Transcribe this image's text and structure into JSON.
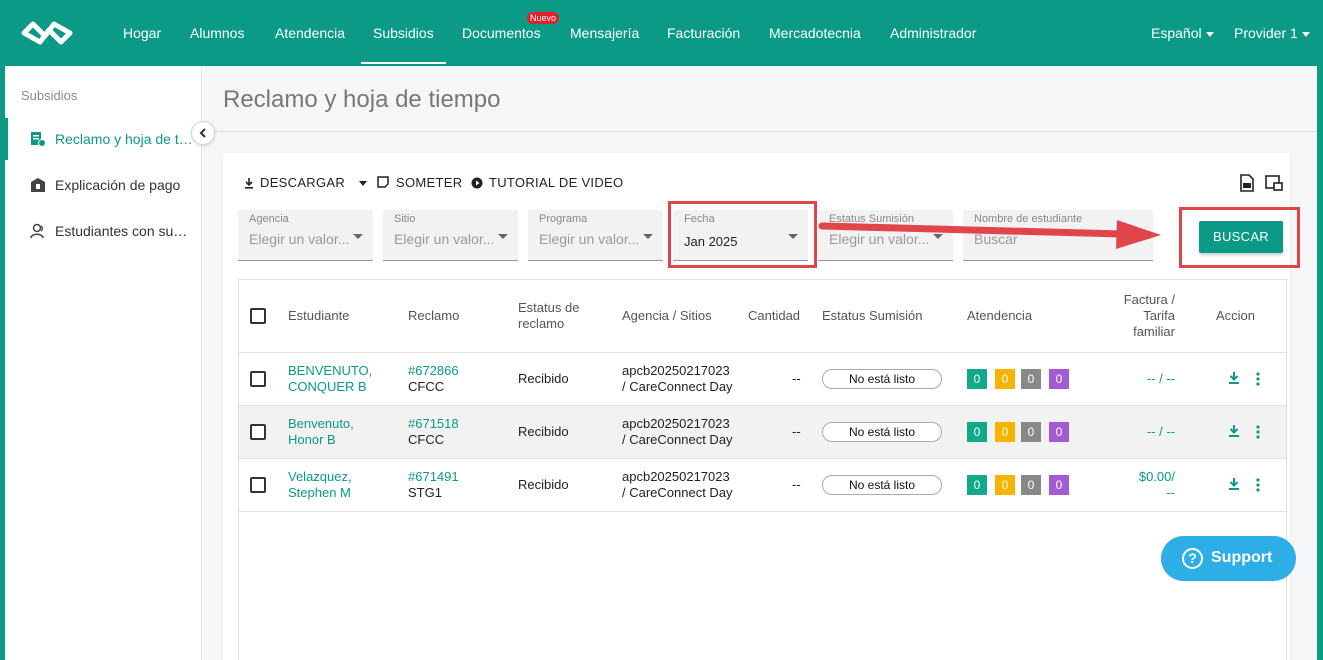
{
  "nav": {
    "items": [
      "Hogar",
      "Alumnos",
      "Atendencia",
      "Subsidios",
      "Documentos",
      "Mensajería",
      "Facturación",
      "Mercadotecnia",
      "Administrador"
    ],
    "active": "Subsidios",
    "new_badge": "Nuevo",
    "language": "Español",
    "user": "Provider 1"
  },
  "sidebar": {
    "heading": "Subsidios",
    "items": [
      {
        "label": "Reclamo y hoja de tiempo",
        "icon": "claim-document-icon"
      },
      {
        "label": "Explicación de pago",
        "icon": "payment-building-icon"
      },
      {
        "label": "Estudiantes con subsidio",
        "icon": "students-icon"
      }
    ]
  },
  "page": {
    "title": "Reclamo y hoja de tiempo"
  },
  "toolbar": {
    "download": "DESCARGAR",
    "submit": "SOMETER",
    "tutorial": "TUTORIAL DE VIDEO"
  },
  "filters": {
    "agency": {
      "label": "Agencia",
      "placeholder": "Elegir un valor..."
    },
    "site": {
      "label": "Sitio",
      "placeholder": "Elegir un valor..."
    },
    "program": {
      "label": "Programa",
      "placeholder": "Elegir un valor..."
    },
    "date": {
      "label": "Fecha",
      "value": "Jan 2025"
    },
    "submission_status": {
      "label": "Estatus Sumisión",
      "placeholder": "Elegir un valor..."
    },
    "student_name": {
      "label": "Nombre de estudiante",
      "placeholder": "Buscar"
    },
    "search_button": "BUSCAR"
  },
  "table": {
    "headers": {
      "student": "Estudiante",
      "claim": "Reclamo",
      "claim_status_1": "Estatus de",
      "claim_status_2": "reclamo",
      "agency_sites": "Agencia / Sitios",
      "amount": "Cantidad",
      "submission_status": "Estatus Sumisión",
      "attendance": "Atendencia",
      "invoice_1": "Factura /",
      "invoice_2": "Tarifa",
      "invoice_3": "familiar",
      "action": "Accion"
    },
    "rows": [
      {
        "student_1": "BENVENUTO,",
        "student_2": "CONQUER B",
        "claim_id": "#672866",
        "claim_type": "CFCC",
        "status": "Recibido",
        "agency_1": "apcb20250217023",
        "agency_2": "/ CareConnect Day",
        "amount": "--",
        "submission": "No está listo",
        "att": [
          "0",
          "0",
          "0",
          "0"
        ],
        "invoice_1": "-- / --",
        "invoice_2": ""
      },
      {
        "student_1": "Benvenuto,",
        "student_2": "Honor B",
        "claim_id": "#671518",
        "claim_type": "CFCC",
        "status": "Recibido",
        "agency_1": "apcb20250217023",
        "agency_2": "/ CareConnect Day",
        "amount": "--",
        "submission": "No está listo",
        "att": [
          "0",
          "0",
          "0",
          "0"
        ],
        "invoice_1": "-- / --",
        "invoice_2": ""
      },
      {
        "student_1": "Velazquez,",
        "student_2": "Stephen M",
        "claim_id": "#671491",
        "claim_type": "STG1",
        "status": "Recibido",
        "agency_1": "apcb20250217023",
        "agency_2": "/ CareConnect Day",
        "amount": "--",
        "submission": "No está listo",
        "att": [
          "0",
          "0",
          "0",
          "0"
        ],
        "invoice_1": "$0.00/",
        "invoice_2": "--"
      }
    ]
  },
  "support": {
    "label": "Support",
    "icon_glyph": "?"
  }
}
